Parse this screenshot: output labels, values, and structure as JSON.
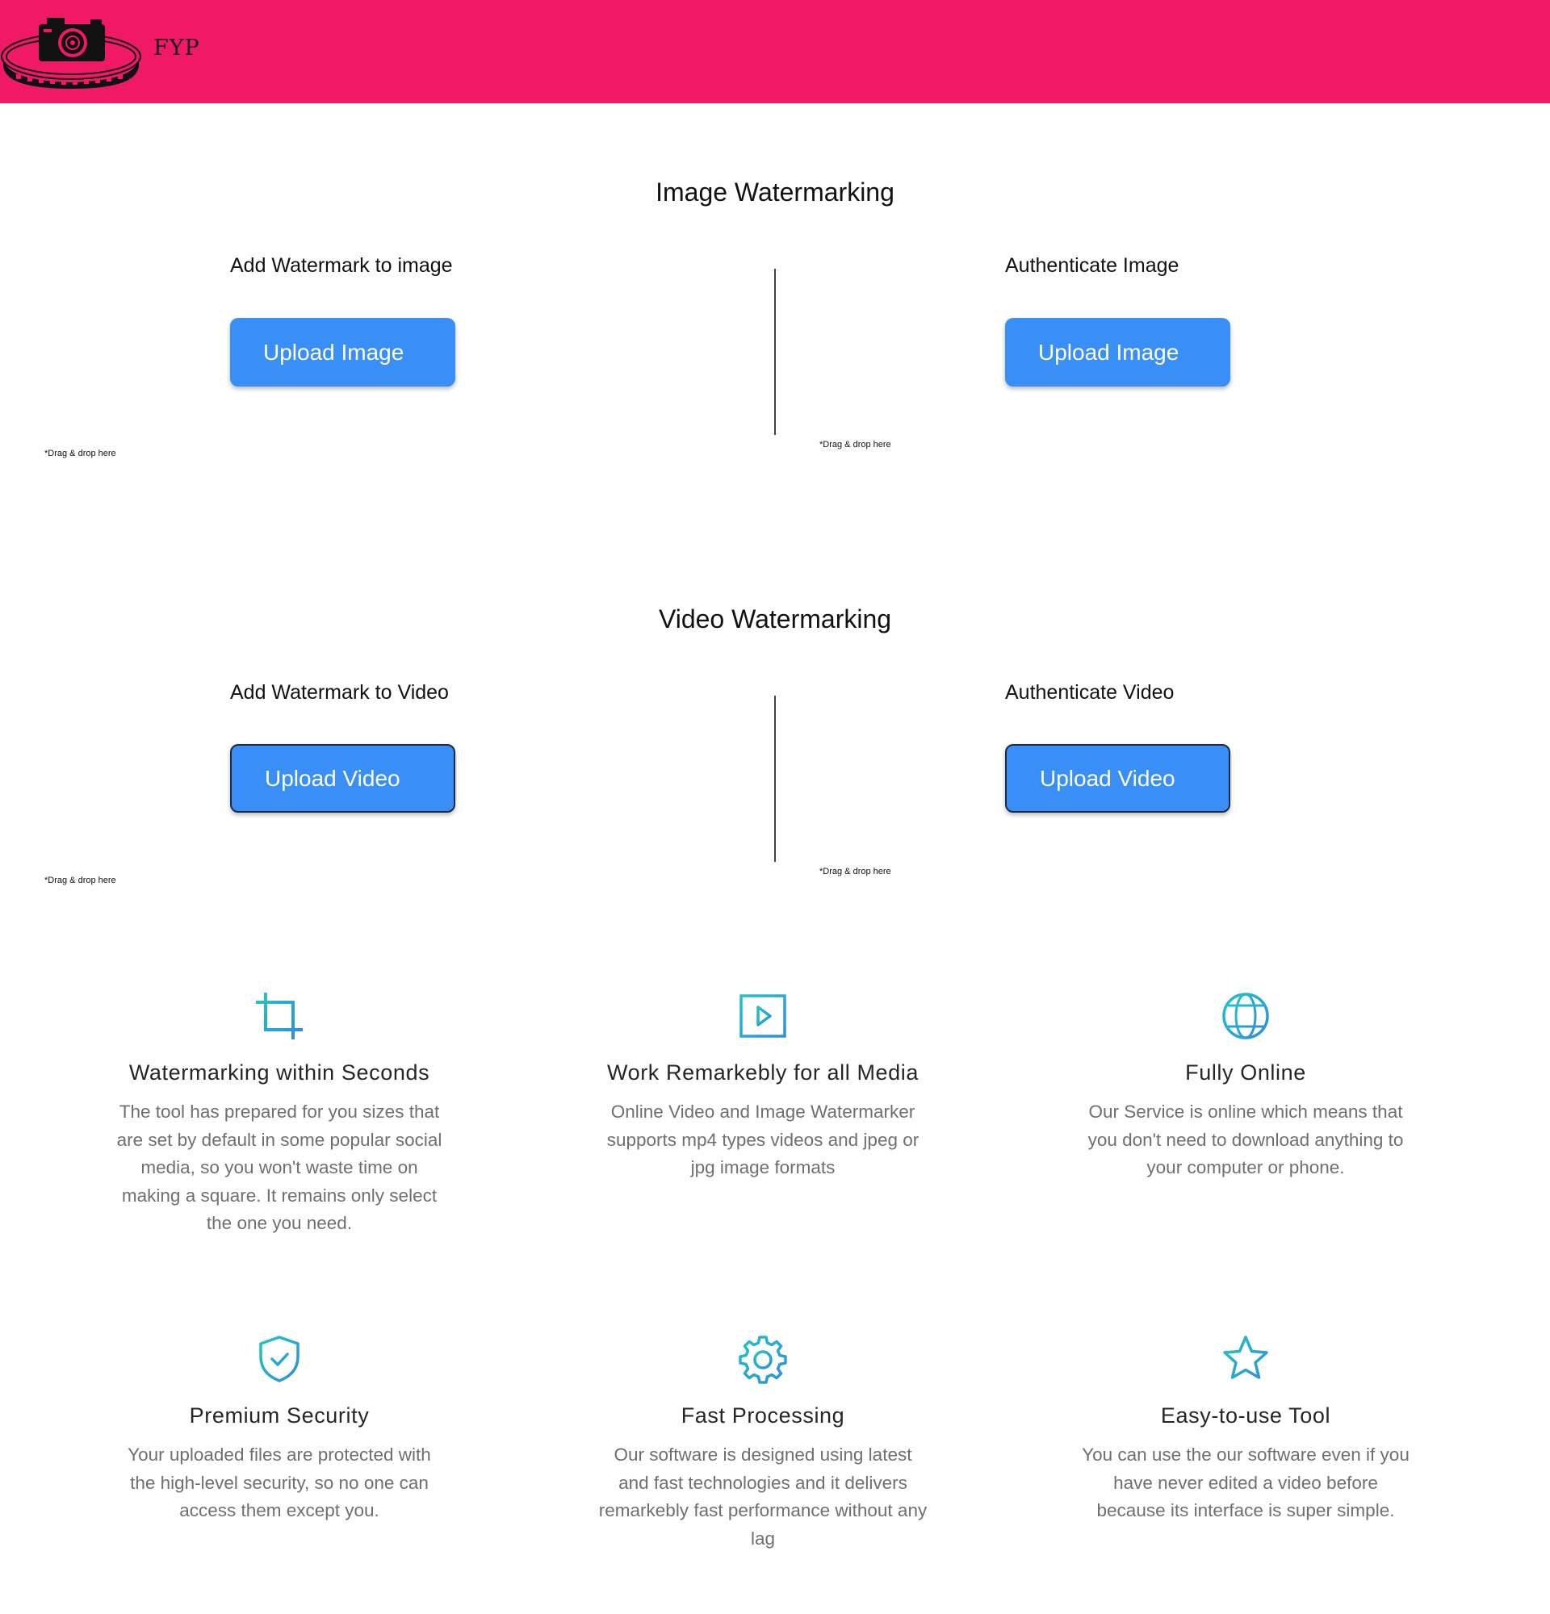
{
  "header": {
    "brand": "FYP",
    "background": "#f01965"
  },
  "image_section": {
    "title": "Image Watermarking",
    "left": {
      "title": "Add Watermark to image",
      "button": "Upload Image",
      "hint": "*Drag & drop here"
    },
    "right": {
      "title": "Authenticate Image",
      "button": "Upload Image",
      "hint": "*Drag & drop here"
    }
  },
  "video_section": {
    "title": "Video Watermarking",
    "left": {
      "title": "Add Watermark to Video",
      "button": "Upload Video",
      "hint": "*Drag & drop here"
    },
    "right": {
      "title": "Authenticate Video",
      "button": "Upload Video",
      "hint": "*Drag & drop here"
    }
  },
  "features": [
    {
      "icon": "crop-icon",
      "title": "Watermarking within Seconds",
      "description": "The tool has prepared for you sizes that are set by default in some popular social media, so you won't waste time on making a square. It remains only select the one you need."
    },
    {
      "icon": "video-play-icon",
      "title": "Work Remarkebly for all Media",
      "description": "Online Video and Image Watermarker supports mp4 types videos and jpeg or jpg image formats"
    },
    {
      "icon": "globe-icon",
      "title": "Fully Online",
      "description": "Our Service is online which means that you don't need to download anything to your computer or phone."
    },
    {
      "icon": "shield-check-icon",
      "title": "Premium Security",
      "description": "Your uploaded files are protected with the high-level security, so no one can access them except you."
    },
    {
      "icon": "gear-icon",
      "title": "Fast Processing",
      "description": "Our software is designed using latest and fast technologies and it delivers remarkebly fast performance without any lag"
    },
    {
      "icon": "star-icon",
      "title": "Easy-to-use Tool",
      "description": "You can use the our software even if you have never edited a video before because its interface is super simple."
    }
  ],
  "colors": {
    "accent_button": "#3a8ff6",
    "icon_gradient_start": "#22c3c8",
    "icon_gradient_end": "#2f8fd8",
    "feature_title": "#262626",
    "feature_text": "#6f6f6f"
  }
}
